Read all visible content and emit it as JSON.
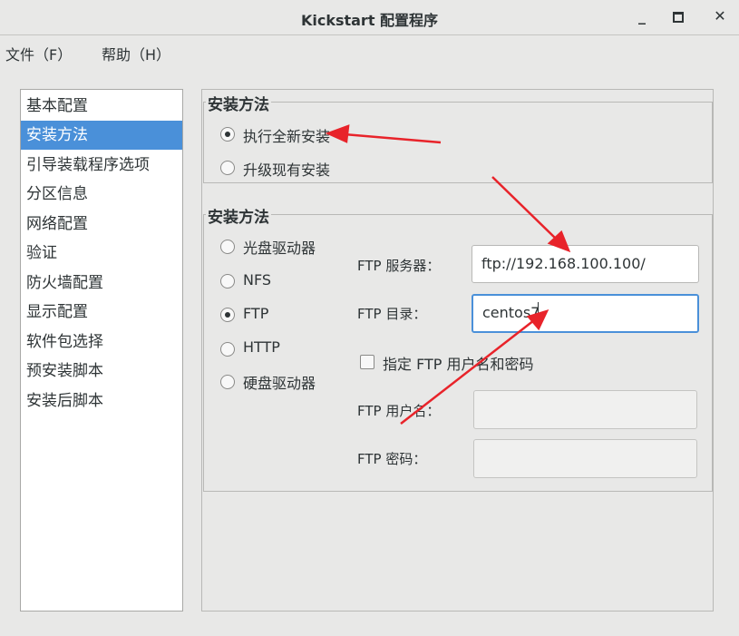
{
  "window": {
    "title": "Kickstart 配置程序",
    "minimize": "_",
    "maximize": "□",
    "close": "✕"
  },
  "menu": {
    "file": "文件（F）",
    "help": "帮助（H）"
  },
  "sidebar": {
    "selected_index": 1,
    "items": [
      {
        "label": "基本配置"
      },
      {
        "label": "安装方法"
      },
      {
        "label": "引导装载程序选项"
      },
      {
        "label": "分区信息"
      },
      {
        "label": "网络配置"
      },
      {
        "label": "验证"
      },
      {
        "label": "防火墙配置"
      },
      {
        "label": "显示配置"
      },
      {
        "label": "软件包选择"
      },
      {
        "label": "预安装脚本"
      },
      {
        "label": "安装后脚本"
      }
    ]
  },
  "install_type": {
    "title": "安装方法",
    "options": [
      {
        "label": "执行全新安装",
        "checked": true
      },
      {
        "label": "升级现有安装",
        "checked": false
      }
    ]
  },
  "install_method": {
    "title": "安装方法",
    "options": [
      {
        "label": "光盘驱动器",
        "checked": false
      },
      {
        "label": "NFS",
        "checked": false
      },
      {
        "label": "FTP",
        "checked": true
      },
      {
        "label": "HTTP",
        "checked": false
      },
      {
        "label": "硬盘驱动器",
        "checked": false
      }
    ],
    "ftp_server_label": "FTP 服务器：",
    "ftp_server_value": "ftp://192.168.100.100/",
    "ftp_dir_label": "FTP 目录：",
    "ftp_dir_value": "centos7",
    "specify_user_label": "指定  FTP 用户名和密码",
    "specify_user_checked": false,
    "ftp_user_label": "FTP 用户名：",
    "ftp_user_value": "",
    "ftp_password_label": "FTP 密码：",
    "ftp_password_value": ""
  },
  "annotation_color": "#e8232a"
}
